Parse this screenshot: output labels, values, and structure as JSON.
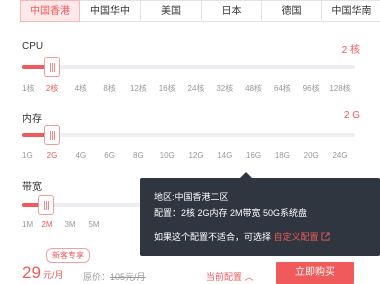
{
  "regions": [
    "中国香港",
    "中国华中",
    "美国",
    "日本",
    "德国",
    "中国华南"
  ],
  "cpu": {
    "label": "CPU",
    "value": "2 核",
    "ticks": [
      "1核",
      "2核",
      "4核",
      "8核",
      "12核",
      "16核",
      "24核",
      "32核",
      "48核",
      "64核",
      "96核",
      "128核"
    ],
    "selected": 1
  },
  "memory": {
    "label": "内存",
    "value": "2 G",
    "ticks": [
      "1G",
      "2G",
      "4G",
      "6G",
      "8G",
      "10G",
      "12G",
      "14G",
      "16G",
      "18G",
      "20G",
      "24G"
    ],
    "selected": 1
  },
  "bandwidth": {
    "label": "带宽",
    "ticks": [
      "1M",
      "2M",
      "3M",
      "5M"
    ],
    "selected": 1
  },
  "tooltip": {
    "region": "地区:中国香港二区",
    "config": "配置：2核 2G内存 2M带宽 50G系统盘",
    "hint": "如果这个配置不适合，可选择",
    "link": "自定义配置"
  },
  "footer": {
    "badge": "新客专享",
    "price": "29",
    "price_unit": "元/月",
    "orig_label": "原价：",
    "orig_price": "105元/月",
    "current_config": "当前配置 ︿",
    "buy": "立即购买"
  },
  "colors": {
    "accent": "#f05a5a",
    "tooltip_bg": "#2f3640"
  }
}
